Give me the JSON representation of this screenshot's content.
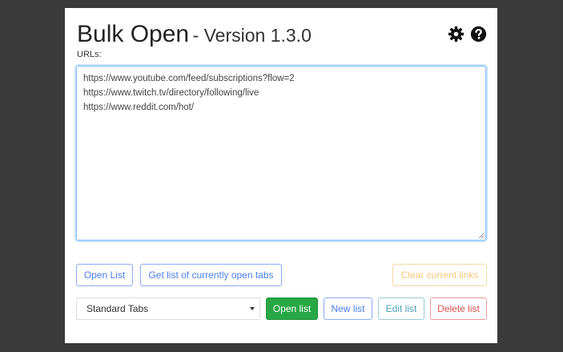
{
  "header": {
    "title": "Bulk Open",
    "version": "- Version 1.3.0",
    "icons": [
      "gear-icon",
      "help-icon"
    ]
  },
  "urls": {
    "label": "URLs:",
    "lines": [
      "https://www.youtube.com/feed/subscriptions?flow=2",
      "https://www.twitch.tv/directory/following/live",
      "https://www.reddit.com/hot/"
    ]
  },
  "actions_row1": {
    "open_list": "Open List",
    "get_open_tabs": "Get list of currently open tabs",
    "clear_links": "Clear current links"
  },
  "actions_row2": {
    "select_value": "Standard Tabs",
    "open_list": "Open list",
    "new_list": "New list",
    "edit_list": "Edit list",
    "delete_list": "Delete list"
  },
  "colors": {
    "primary_blue": "#4b7ff0",
    "success_green": "#27a745",
    "warning_orange": "#f5c77a",
    "info_teal": "#4ea1b8",
    "danger_red": "#d9534f",
    "focus_border": "#80bdff"
  }
}
